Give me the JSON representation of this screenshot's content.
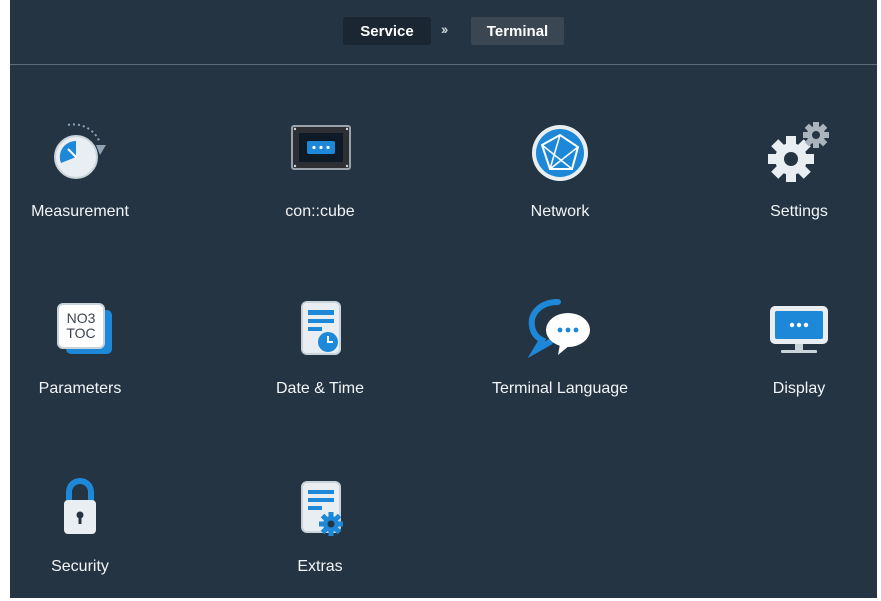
{
  "breadcrumb": {
    "items": [
      "Service",
      "Terminal"
    ],
    "separator": "››"
  },
  "tiles": [
    {
      "label": "Measurement",
      "icon": "clock-icon"
    },
    {
      "label": "con::cube",
      "icon": "device-icon"
    },
    {
      "label": "Network",
      "icon": "globe-network-icon"
    },
    {
      "label": "Settings",
      "icon": "gears-icon"
    },
    {
      "label": "Parameters",
      "icon": "parameters-card-icon",
      "icon_text": [
        "NO3",
        "TOC"
      ]
    },
    {
      "label": "Date & Time",
      "icon": "calendar-clock-icon"
    },
    {
      "label": "Terminal Language",
      "icon": "speech-bubbles-icon"
    },
    {
      "label": "Display",
      "icon": "monitor-icon"
    },
    {
      "label": "Security",
      "icon": "padlock-icon"
    },
    {
      "label": "Extras",
      "icon": "document-gear-icon"
    }
  ],
  "colors": {
    "background": "#243443",
    "accent_blue": "#1e88d8",
    "text": "#f2f4f6"
  }
}
